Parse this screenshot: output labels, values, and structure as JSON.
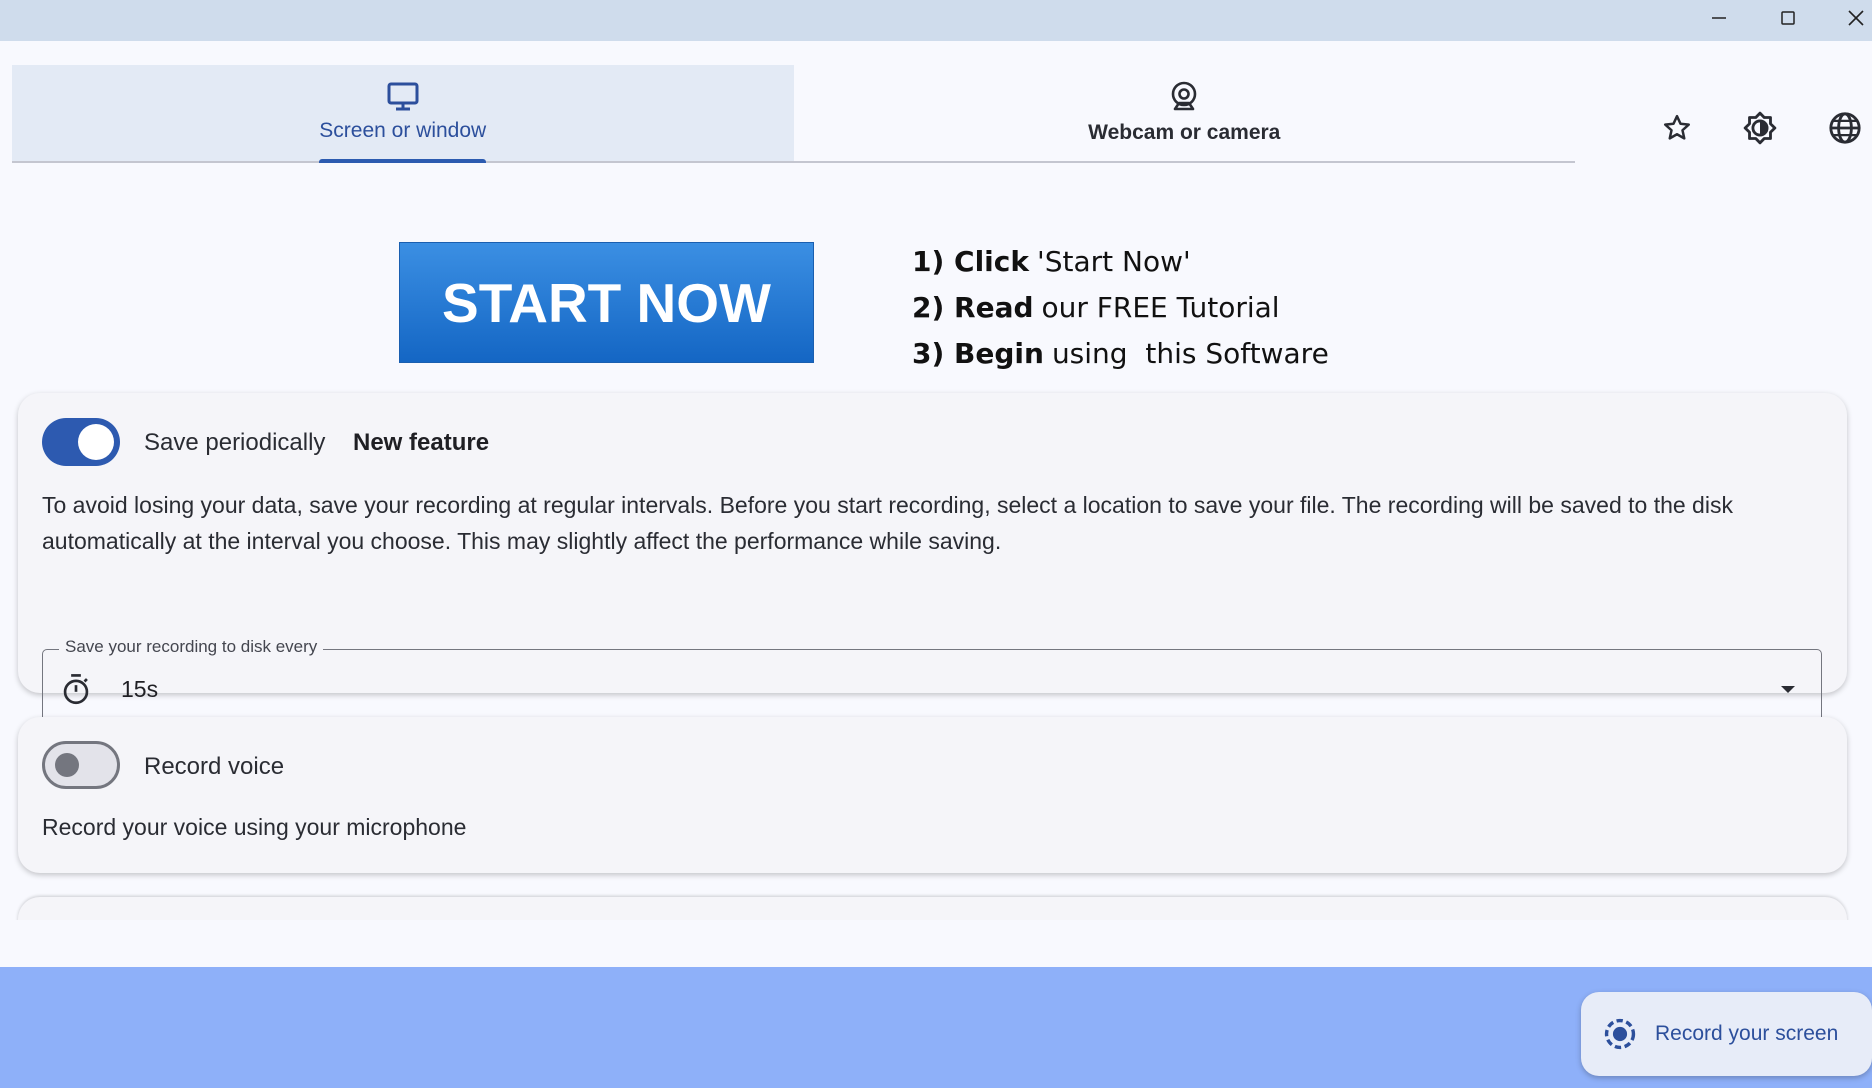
{
  "window": {
    "minimize_icon": "minimize-icon",
    "maximize_icon": "maximize-icon",
    "close_icon": "close-icon"
  },
  "tabs": [
    {
      "label": "Screen or window",
      "icon": "monitor-icon",
      "active": true
    },
    {
      "label": "Webcam or camera",
      "icon": "webcam-icon",
      "active": false
    }
  ],
  "toolbar": {
    "icons": [
      "star-icon",
      "brightness-icon",
      "globe-icon"
    ]
  },
  "promo": {
    "button_label": "START NOW",
    "steps": [
      {
        "bold": "1) Click",
        "text": "'Start Now'"
      },
      {
        "bold": "2) Read",
        "text": "our FREE Tutorial"
      },
      {
        "bold": "3) Begin",
        "text": "using  this Software"
      }
    ]
  },
  "save_periodically": {
    "enabled": true,
    "title": "Save periodically",
    "badge": "New feature",
    "description": "To avoid losing your data, save your recording at regular intervals. Before you start recording, select a location to save your file. The recording will be saved to the disk automatically at the interval you choose. This may slightly affect the performance while saving.",
    "interval_label": "Save your recording to disk every",
    "interval_value": "15s"
  },
  "record_voice": {
    "enabled": false,
    "title": "Record voice",
    "description": "Record your voice using your microphone"
  },
  "record_button": {
    "label": "Record your screen",
    "icon": "record-icon"
  },
  "colors": {
    "accent": "#2d5ab0",
    "bottom_bar": "#8eb0f9",
    "titlebar": "#cfdcec"
  }
}
